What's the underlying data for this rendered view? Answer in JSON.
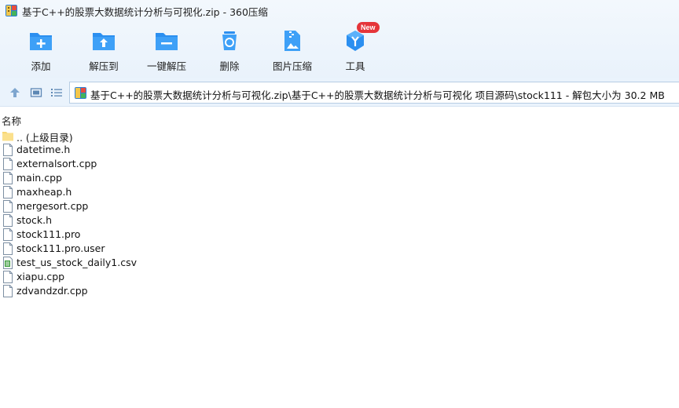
{
  "window": {
    "title": "基于C++的股票大数据统计分析与可视化.zip - 360压缩"
  },
  "toolbar": {
    "buttons": [
      {
        "label": "添加",
        "icon": "add-folder-icon"
      },
      {
        "label": "解压到",
        "icon": "extract-to-icon"
      },
      {
        "label": "一键解压",
        "icon": "one-click-extract-icon"
      },
      {
        "label": "删除",
        "icon": "delete-icon"
      },
      {
        "label": "图片压缩",
        "icon": "image-compress-icon"
      },
      {
        "label": "工具",
        "icon": "tools-icon",
        "badge": "New"
      }
    ]
  },
  "address": {
    "path": "基于C++的股票大数据统计分析与可视化.zip\\基于C++的股票大数据统计分析与可视化 项目源码\\stock111 - 解包大小为 30.2 MB"
  },
  "list": {
    "column_name": "名称",
    "items": [
      {
        "name": ".. (上级目录)",
        "type": "folder"
      },
      {
        "name": "datetime.h",
        "type": "file"
      },
      {
        "name": "externalsort.cpp",
        "type": "file"
      },
      {
        "name": "main.cpp",
        "type": "file"
      },
      {
        "name": "maxheap.h",
        "type": "file"
      },
      {
        "name": "mergesort.cpp",
        "type": "file"
      },
      {
        "name": "stock.h",
        "type": "file"
      },
      {
        "name": "stock111.pro",
        "type": "file"
      },
      {
        "name": "stock111.pro.user",
        "type": "file"
      },
      {
        "name": "test_us_stock_daily1.csv",
        "type": "csv"
      },
      {
        "name": "xiapu.cpp",
        "type": "file"
      },
      {
        "name": "zdvandzdr.cpp",
        "type": "file"
      }
    ]
  },
  "colors": {
    "accent_blue": "#2b8ff0",
    "badge_red": "#e5353a",
    "folder_yellow": "#f7d774",
    "csv_green": "#3a9a3a"
  }
}
